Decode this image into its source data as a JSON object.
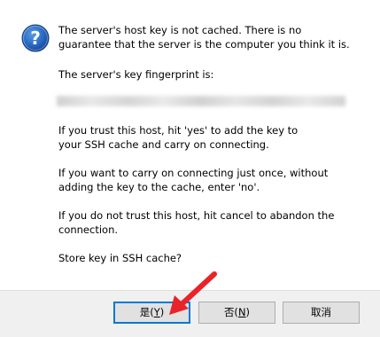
{
  "message": {
    "line1": "The server's host key is not cached. There is no",
    "line2": "guarantee that the server is the computer you think it is.",
    "line3": "The server's key fingerprint is:",
    "line4": "If you trust this host, hit 'yes' to add the key to",
    "line5": "your SSH cache and carry on connecting.",
    "line6": "If you want to carry on connecting just once, without",
    "line7": "adding the key to the cache, enter 'no'.",
    "line8": "If you do not trust this host, hit cancel to abandon the",
    "line9": "connection.",
    "line10": "Store key in SSH cache?"
  },
  "buttons": {
    "yes_label": "是(",
    "yes_mnemonic": "Y",
    "yes_close": ")",
    "no_label": "否(",
    "no_mnemonic": "N",
    "no_close": ")",
    "cancel_label": "取消"
  },
  "icons": {
    "question": "question-icon",
    "annotation": "red-arrow"
  },
  "colors": {
    "icon_blue": "#1f5fb4",
    "arrow_red": "#e8242a",
    "focus_border": "#0078d7"
  }
}
